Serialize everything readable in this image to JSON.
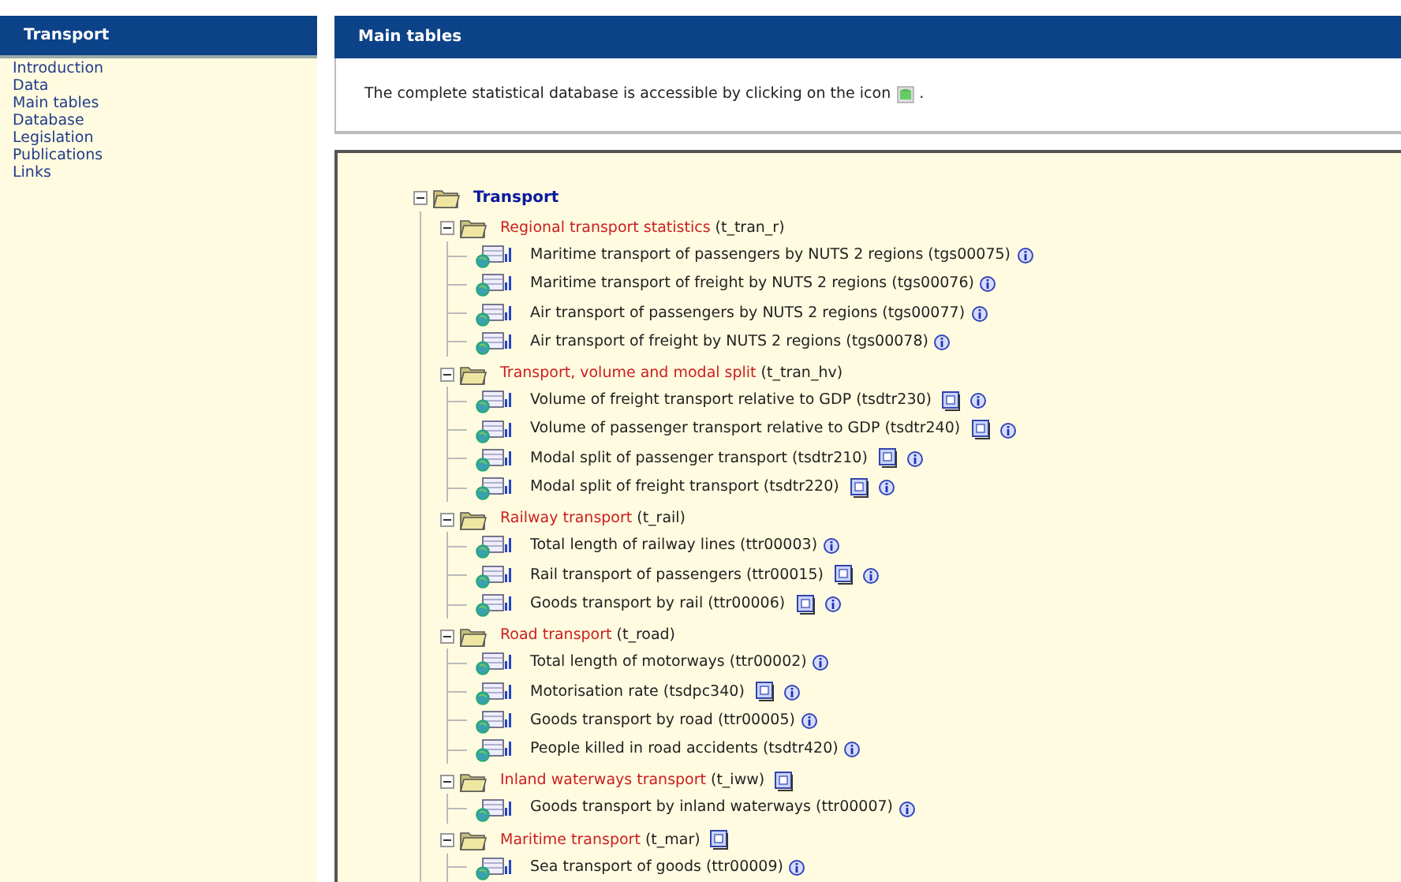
{
  "sidebar": {
    "title": "Transport",
    "items": [
      "Introduction",
      "Data",
      "Main tables",
      "Database",
      "Legislation",
      "Publications",
      "Links"
    ]
  },
  "main": {
    "title": "Main tables",
    "intro": "The complete statistical database is accessible by clicking on the icon",
    "intro_end": ".",
    "tree": {
      "label": "Transport",
      "expanded": true,
      "groups": [
        {
          "label": "Regional transport statistics",
          "code": "(t_tran_r)",
          "expanded": true,
          "has_doc": false,
          "items": [
            {
              "label": "Maritime transport of passengers by NUTS 2 regions (tgs00075)",
              "has_doc": false
            },
            {
              "label": "Maritime transport of freight by NUTS 2 regions (tgs00076)",
              "has_doc": false
            },
            {
              "label": "Air transport of passengers by NUTS 2 regions (tgs00077)",
              "has_doc": false
            },
            {
              "label": "Air transport of freight by NUTS 2 regions (tgs00078)",
              "has_doc": false
            }
          ]
        },
        {
          "label": "Transport, volume and modal split",
          "code": "(t_tran_hv)",
          "expanded": true,
          "has_doc": false,
          "items": [
            {
              "label": "Volume of freight transport relative to GDP (tsdtr230)",
              "has_doc": true
            },
            {
              "label": "Volume of passenger transport relative to GDP (tsdtr240)",
              "has_doc": true
            },
            {
              "label": "Modal split of passenger transport (tsdtr210)",
              "has_doc": true
            },
            {
              "label": "Modal split of freight transport (tsdtr220)",
              "has_doc": true
            }
          ]
        },
        {
          "label": "Railway transport",
          "code": "(t_rail)",
          "expanded": true,
          "has_doc": false,
          "items": [
            {
              "label": "Total length of railway lines (ttr00003)",
              "has_doc": false
            },
            {
              "label": "Rail transport of passengers (ttr00015)",
              "has_doc": true
            },
            {
              "label": "Goods transport by rail (ttr00006)",
              "has_doc": true
            }
          ]
        },
        {
          "label": "Road transport",
          "code": "(t_road)",
          "expanded": true,
          "has_doc": false,
          "items": [
            {
              "label": "Total length of motorways (ttr00002)",
              "has_doc": false
            },
            {
              "label": "Motorisation rate (tsdpc340)",
              "has_doc": true
            },
            {
              "label": "Goods transport by road (ttr00005)",
              "has_doc": false
            },
            {
              "label": "People killed in road accidents (tsdtr420)",
              "has_doc": false
            }
          ]
        },
        {
          "label": "Inland waterways transport",
          "code": "(t_iww)",
          "expanded": true,
          "has_doc": true,
          "items": [
            {
              "label": "Goods transport by inland waterways (ttr00007)",
              "has_doc": false
            }
          ]
        },
        {
          "label": "Maritime transport",
          "code": "(t_mar)",
          "expanded": true,
          "has_doc": true,
          "items": [
            {
              "label": "Sea transport of goods (ttr00009)",
              "has_doc": false
            }
          ]
        }
      ]
    }
  }
}
